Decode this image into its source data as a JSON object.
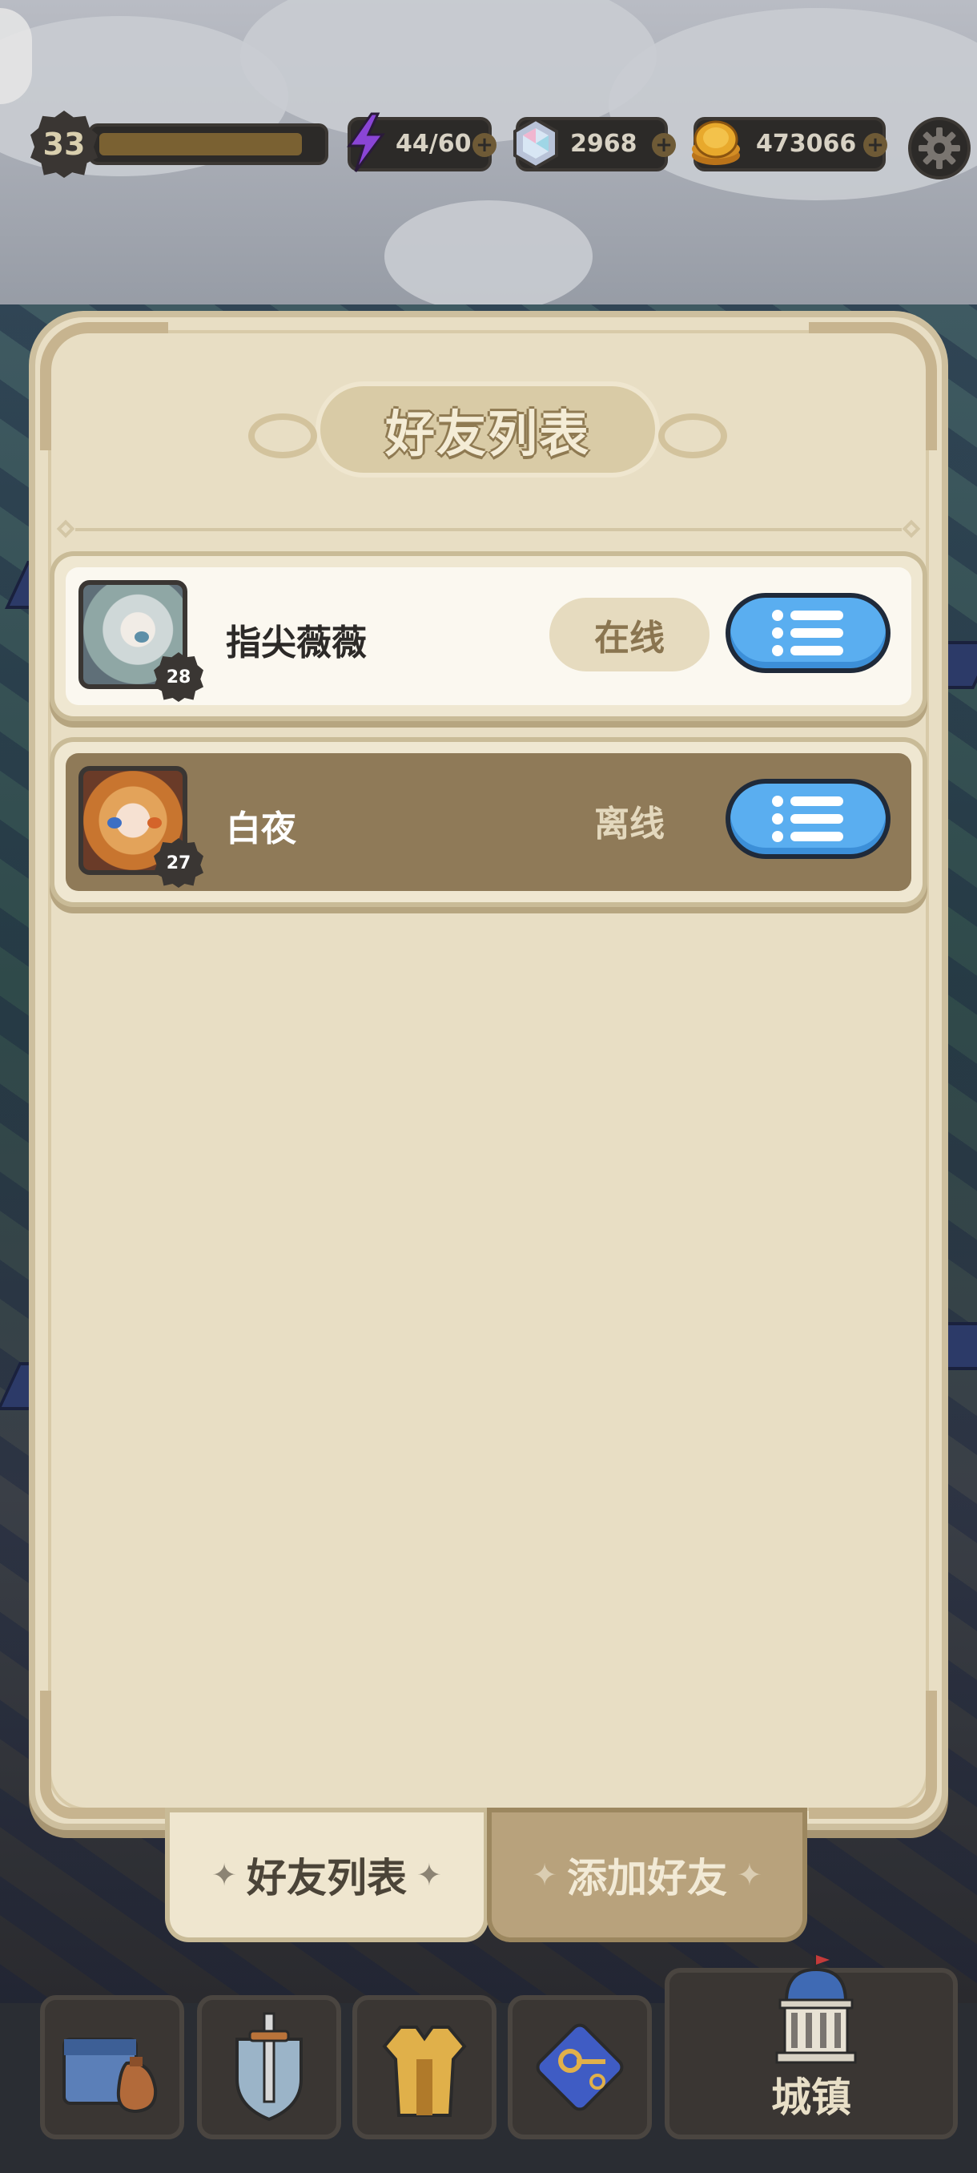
{
  "status_bar": {
    "level": "33",
    "xp_fraction": 0.93,
    "energy": "44/60",
    "gems": "2968",
    "gold": "473066",
    "plus_symbol": "+"
  },
  "panel": {
    "title": "好友列表"
  },
  "friends": [
    {
      "name": "指尖薇薇",
      "level": "28",
      "status": "在线",
      "online": true
    },
    {
      "name": "白夜",
      "level": "27",
      "status": "离线",
      "online": false
    }
  ],
  "tabs": {
    "friend_list": "好友列表",
    "add_friend": "添加好友"
  },
  "nav": {
    "town_label": "城镇"
  },
  "colors": {
    "panel_bg": "#e8dec4",
    "accent_blue": "#5aaef0",
    "offline_row": "#8f7a58"
  }
}
